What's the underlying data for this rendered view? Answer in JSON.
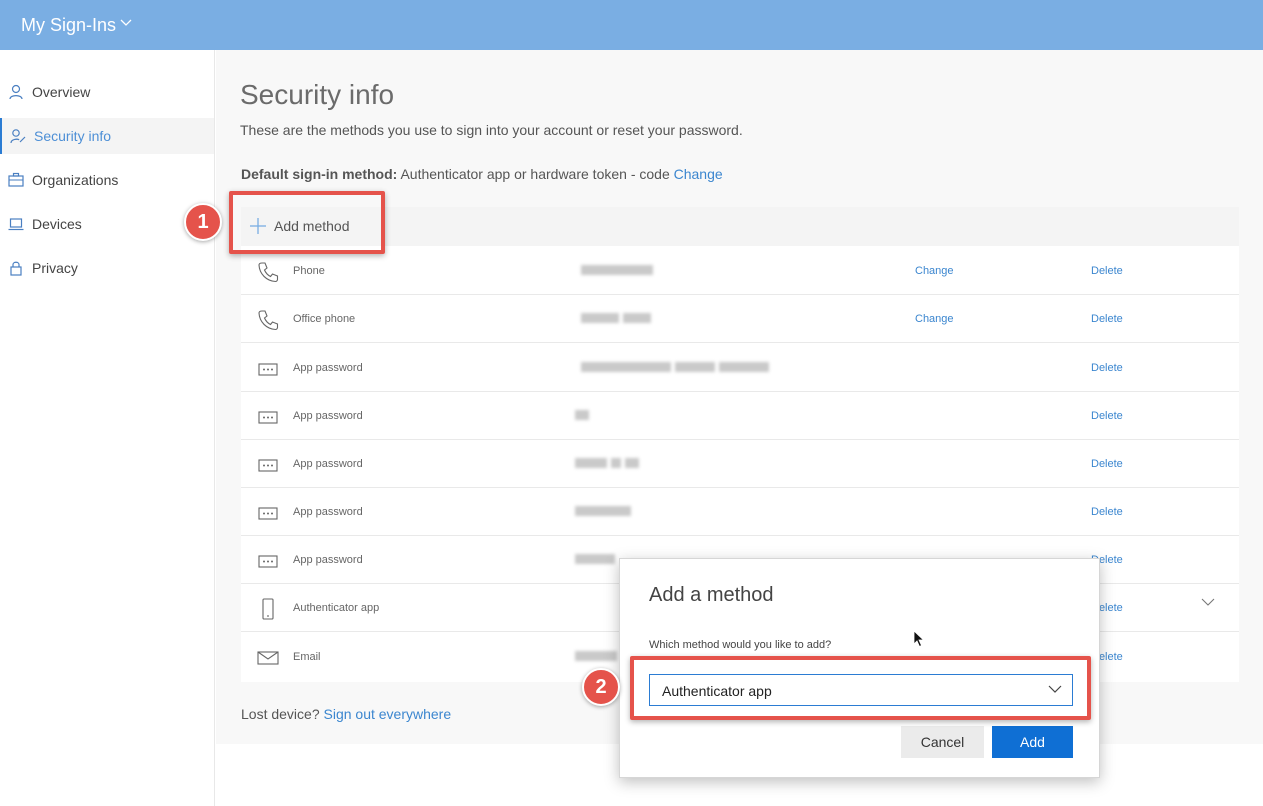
{
  "app": {
    "title": "My Sign-Ins"
  },
  "sidebar": {
    "items": [
      {
        "label": "Overview",
        "icon": "person-icon"
      },
      {
        "label": "Security info",
        "icon": "person-key-icon",
        "active": true
      },
      {
        "label": "Organizations",
        "icon": "briefcase-icon"
      },
      {
        "label": "Devices",
        "icon": "laptop-icon"
      },
      {
        "label": "Privacy",
        "icon": "lock-icon"
      }
    ]
  },
  "page": {
    "title": "Security info",
    "description": "These are the methods you use to sign into your account or reset your password.",
    "default_label": "Default sign-in method:",
    "default_value": "Authenticator app or hardware token - code",
    "default_change": "Change",
    "add_method": "Add method",
    "lost_device": "Lost device?",
    "sign_out_everywhere": "Sign out everywhere"
  },
  "methods": [
    {
      "name": "Phone",
      "icon": "phone-icon",
      "change": "Change",
      "delete": "Delete"
    },
    {
      "name": "Office phone",
      "icon": "phone-icon",
      "change": "Change",
      "delete": "Delete"
    },
    {
      "name": "App password",
      "icon": "password-dots-icon",
      "delete": "Delete"
    },
    {
      "name": "App password",
      "icon": "password-dots-icon",
      "delete": "Delete"
    },
    {
      "name": "App password",
      "icon": "password-dots-icon",
      "delete": "Delete"
    },
    {
      "name": "App password",
      "icon": "password-dots-icon",
      "delete": "Delete"
    },
    {
      "name": "App password",
      "icon": "password-dots-icon",
      "delete": "Delete"
    },
    {
      "name": "Authenticator app",
      "icon": "mobile-phone-icon",
      "delete": "Delete"
    },
    {
      "name": "Email",
      "icon": "envelope-icon",
      "delete": "Delete"
    }
  ],
  "annotations": {
    "step1": "1",
    "step2": "2",
    "color": "#e5534b"
  },
  "dialog": {
    "title": "Add a method",
    "question": "Which method would you like to add?",
    "selected": "Authenticator app",
    "cancel": "Cancel",
    "add": "Add"
  },
  "colors": {
    "topbar": "#7aaee3",
    "link": "#3b86cf",
    "primary": "#0f6fd4"
  }
}
